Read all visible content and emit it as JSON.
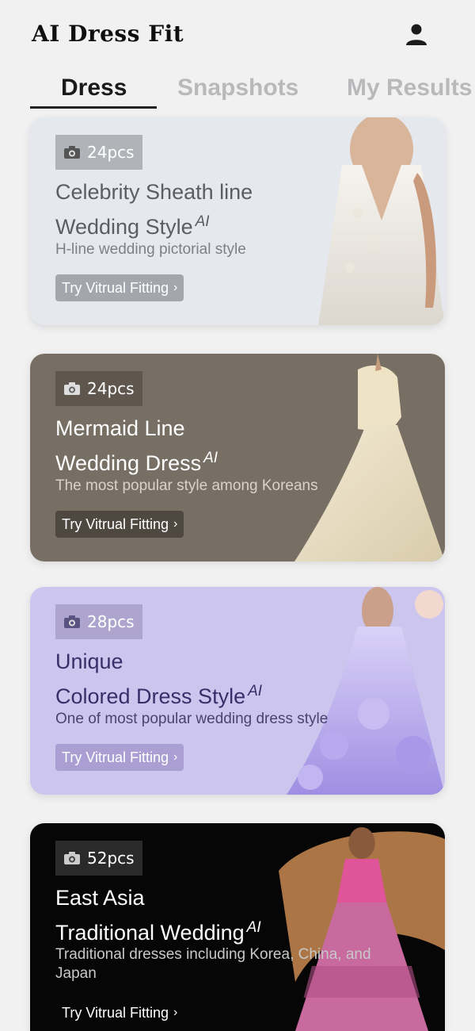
{
  "header": {
    "title": "AI Dress Fit"
  },
  "tabs": [
    {
      "label": "Dress",
      "active": true
    },
    {
      "label": "Snapshots",
      "active": false
    },
    {
      "label": "My Results",
      "active": false
    }
  ],
  "cards": [
    {
      "count": "24pcs",
      "title_line1": "Celebrity Sheath line",
      "title_line2": "Wedding Style",
      "ai": "AI",
      "subtitle": "H-line wedding pictorial style",
      "button": "Try Vitrual Fitting"
    },
    {
      "count": "24pcs",
      "title_line1": "Mermaid Line",
      "title_line2": "Wedding Dress",
      "ai": "AI",
      "subtitle": "The most popular style among Koreans",
      "button": "Try Vitrual Fitting"
    },
    {
      "count": "28pcs",
      "title_line1": "Unique",
      "title_line2": "Colored Dress Style",
      "ai": "AI",
      "subtitle": "One of most popular wedding dress style",
      "button": "Try Vitrual Fitting"
    },
    {
      "count": "52pcs",
      "title_line1": "East Asia",
      "title_line2": "Traditional Wedding",
      "ai": "AI",
      "subtitle": "Traditional dresses including Korea, China, and Japan",
      "button": "Try Vitrual Fitting"
    }
  ],
  "icons": {
    "user": "user-icon",
    "camera": "camera-icon",
    "chevron": "chevron-right-icon"
  },
  "colors": {
    "card1_bg": "#e5e8ed",
    "card2_bg": "#786f64",
    "card3_bg": "#ccc5ed",
    "card4_bg": "#060606"
  }
}
